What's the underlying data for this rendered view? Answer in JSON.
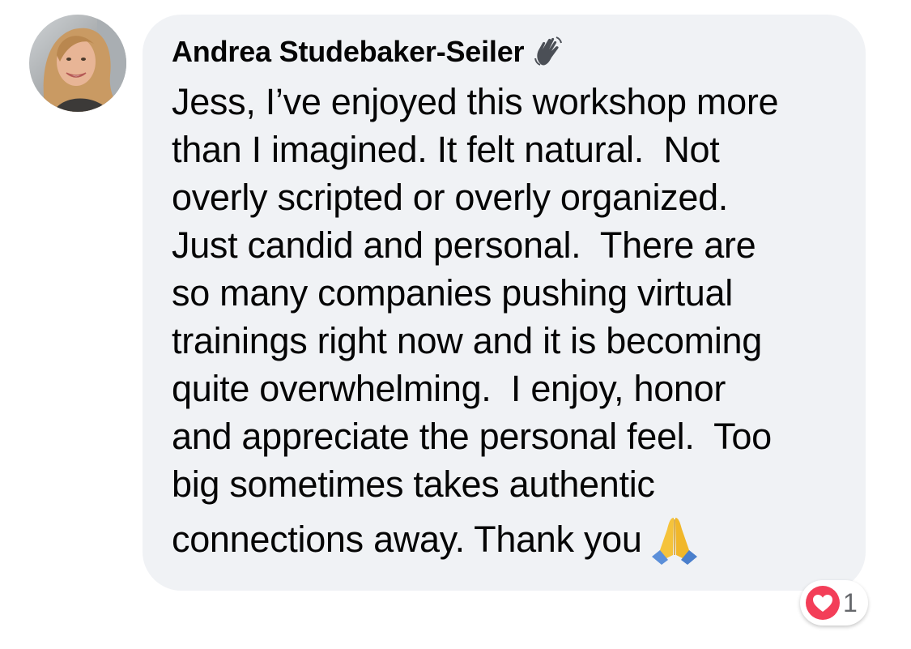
{
  "comment": {
    "author": "Andrea Studebaker-Seiler",
    "author_badge_icon": "waving-hand-icon",
    "lines": [
      "Jess, I’ve enjoyed this workshop more",
      "than I imagined. It felt natural.  Not",
      "overly scripted or overly organized.",
      "Just candid and personal.  There are",
      "so many companies pushing virtual",
      "trainings right now and it is becoming",
      "quite overwhelming.  I enjoy, honor",
      "and appreciate the personal feel.  Too",
      "big sometimes takes authentic",
      "connections away. Thank you"
    ],
    "trailing_emoji_icon": "folded-hands-icon",
    "reaction": {
      "icon": "heart-reaction-icon",
      "count": "1",
      "color": "#f33e58"
    }
  },
  "colors": {
    "bubble_background": "#f0f2f5",
    "text": "#050505",
    "count_text": "#65676b"
  }
}
